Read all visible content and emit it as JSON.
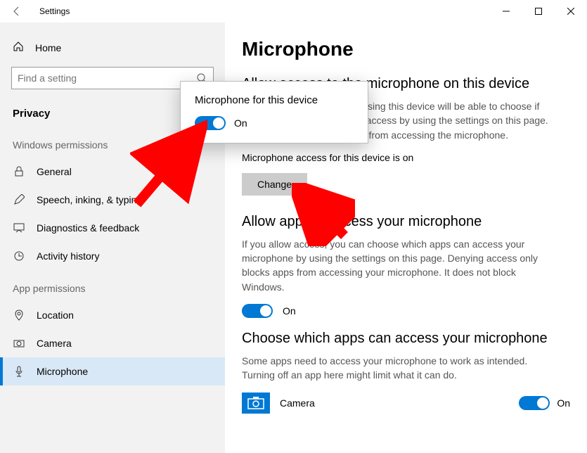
{
  "titlebar": {
    "title": "Settings"
  },
  "sidebar": {
    "home": "Home",
    "search_placeholder": "Find a setting",
    "active_section": "Privacy",
    "group1_title": "Windows permissions",
    "group1_items": [
      {
        "label": "General"
      },
      {
        "label": "Speech, inking, & typing"
      },
      {
        "label": "Diagnostics & feedback"
      },
      {
        "label": "Activity history"
      }
    ],
    "group2_title": "App permissions",
    "group2_items": [
      {
        "label": "Location"
      },
      {
        "label": "Camera"
      },
      {
        "label": "Microphone"
      }
    ]
  },
  "main": {
    "title": "Microphone",
    "sec1_heading": "Allow access to the microphone on this device",
    "sec1_desc": "If you allow access, people using this device will be able to choose if their apps have microphone access by using the settings on this page. Denying access blocks apps from accessing the microphone.",
    "sec1_status": "Microphone access for this device is on",
    "change_btn": "Change",
    "sec2_heading": "Allow apps to access your microphone",
    "sec2_desc": "If you allow access, you can choose which apps can access your microphone by using the settings on this page. Denying access only blocks apps from accessing your microphone. It does not block Windows.",
    "sec2_toggle": "On",
    "sec3_heading": "Choose which apps can access your microphone",
    "sec3_desc": "Some apps need to access your microphone to work as intended. Turning off an app here might limit what it can do.",
    "app_list": [
      {
        "name": "Camera",
        "state": "On"
      }
    ]
  },
  "popup": {
    "title": "Microphone for this device",
    "state": "On"
  }
}
